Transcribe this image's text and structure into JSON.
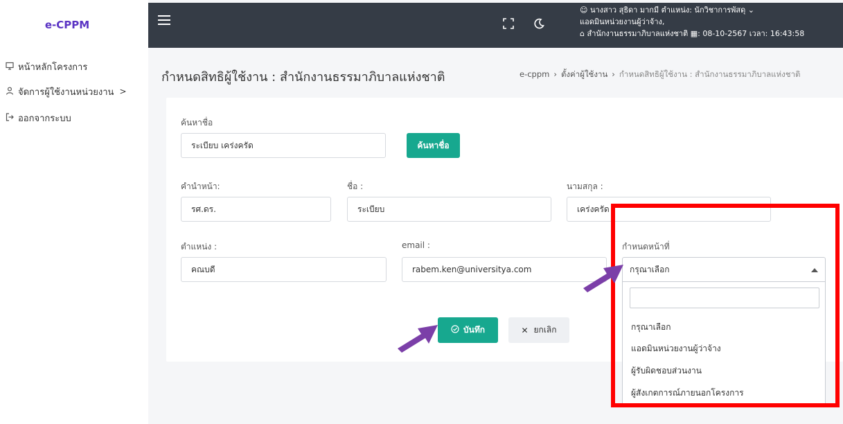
{
  "app": {
    "logo": "e-CPPM"
  },
  "sidebar": {
    "items": [
      {
        "label": "หน้าหลักโครงการ",
        "icon": "monitor-icon"
      },
      {
        "label": "จัดการผู้ใช้งานหน่วยงาน",
        "icon": "user-icon",
        "chevron": ">"
      },
      {
        "label": "ออกจากระบบ",
        "icon": "logout-icon"
      }
    ]
  },
  "topbar": {
    "user_line1": "นางสาว สุธิดา มากมี ตำแหน่ง: นักวิชาการพัสดุ ⌄",
    "user_line2": "แอดมินหน่วยงานผู้ว่าจ้าง,",
    "user_line3": "สำนักงานธรรมาภิบาลแห่งชาติ",
    "date": "08-10-2567",
    "time_label": "เวลา:",
    "time": "16:43:58"
  },
  "page": {
    "title": "กำหนดสิทธิผู้ใช้งาน : สำนักงานธรรมาภิบาลแห่งชาติ",
    "breadcrumb": [
      "e-cppm",
      "ตั้งค่าผู้ใช้งาน",
      "กำหนดสิทธิผู้ใช้งาน : สำนักงานธรรมาภิบาลแห่งชาติ"
    ]
  },
  "form": {
    "search_label": "ค้นหาชื่อ",
    "search_value": "ระเบียบ เคร่งครัด",
    "search_button": "ค้นหาชื่อ",
    "prefix_label": "คำนำหน้า:",
    "prefix_value": "รศ.ดร.",
    "firstname_label": "ชื่อ :",
    "firstname_value": "ระเบียบ",
    "lastname_label": "นามสกุล :",
    "lastname_value": "เคร่งครัด",
    "position_label": "ตำแหน่ง :",
    "position_value": "คณบดี",
    "email_label": "email :",
    "email_value": "rabem.ken@universitya.com",
    "role_label": "กำหนดหน้าที่",
    "role_selected": "กรุณาเลือก",
    "role_options": [
      "กรุณาเลือก",
      "แอดมินหน่วยงานผู้ว่าจ้าง",
      "ผู้รับผิดชอบส่วนงาน",
      "ผู้สังเกตการณ์ภายนอกโครงการ"
    ],
    "save_button": "บันทึก",
    "cancel_button": "ยกเลิก"
  },
  "colors": {
    "brand": "#5b34c4",
    "topbar": "#353c46",
    "accent_green": "#17a88f",
    "highlight_red": "#ff0000",
    "arrow_purple": "#7b3fa8"
  }
}
